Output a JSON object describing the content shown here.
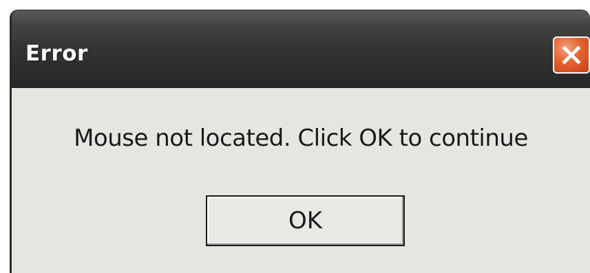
{
  "window": {
    "title": "Error"
  },
  "titlebar": {
    "close_icon": "close-icon"
  },
  "message": {
    "text": "Mouse not located. Click OK to continue"
  },
  "buttons": {
    "ok_label": "OK"
  },
  "colors": {
    "titlebar": "#333333",
    "close_button": "#e2622f",
    "dialog_background": "#e6e5e2"
  }
}
